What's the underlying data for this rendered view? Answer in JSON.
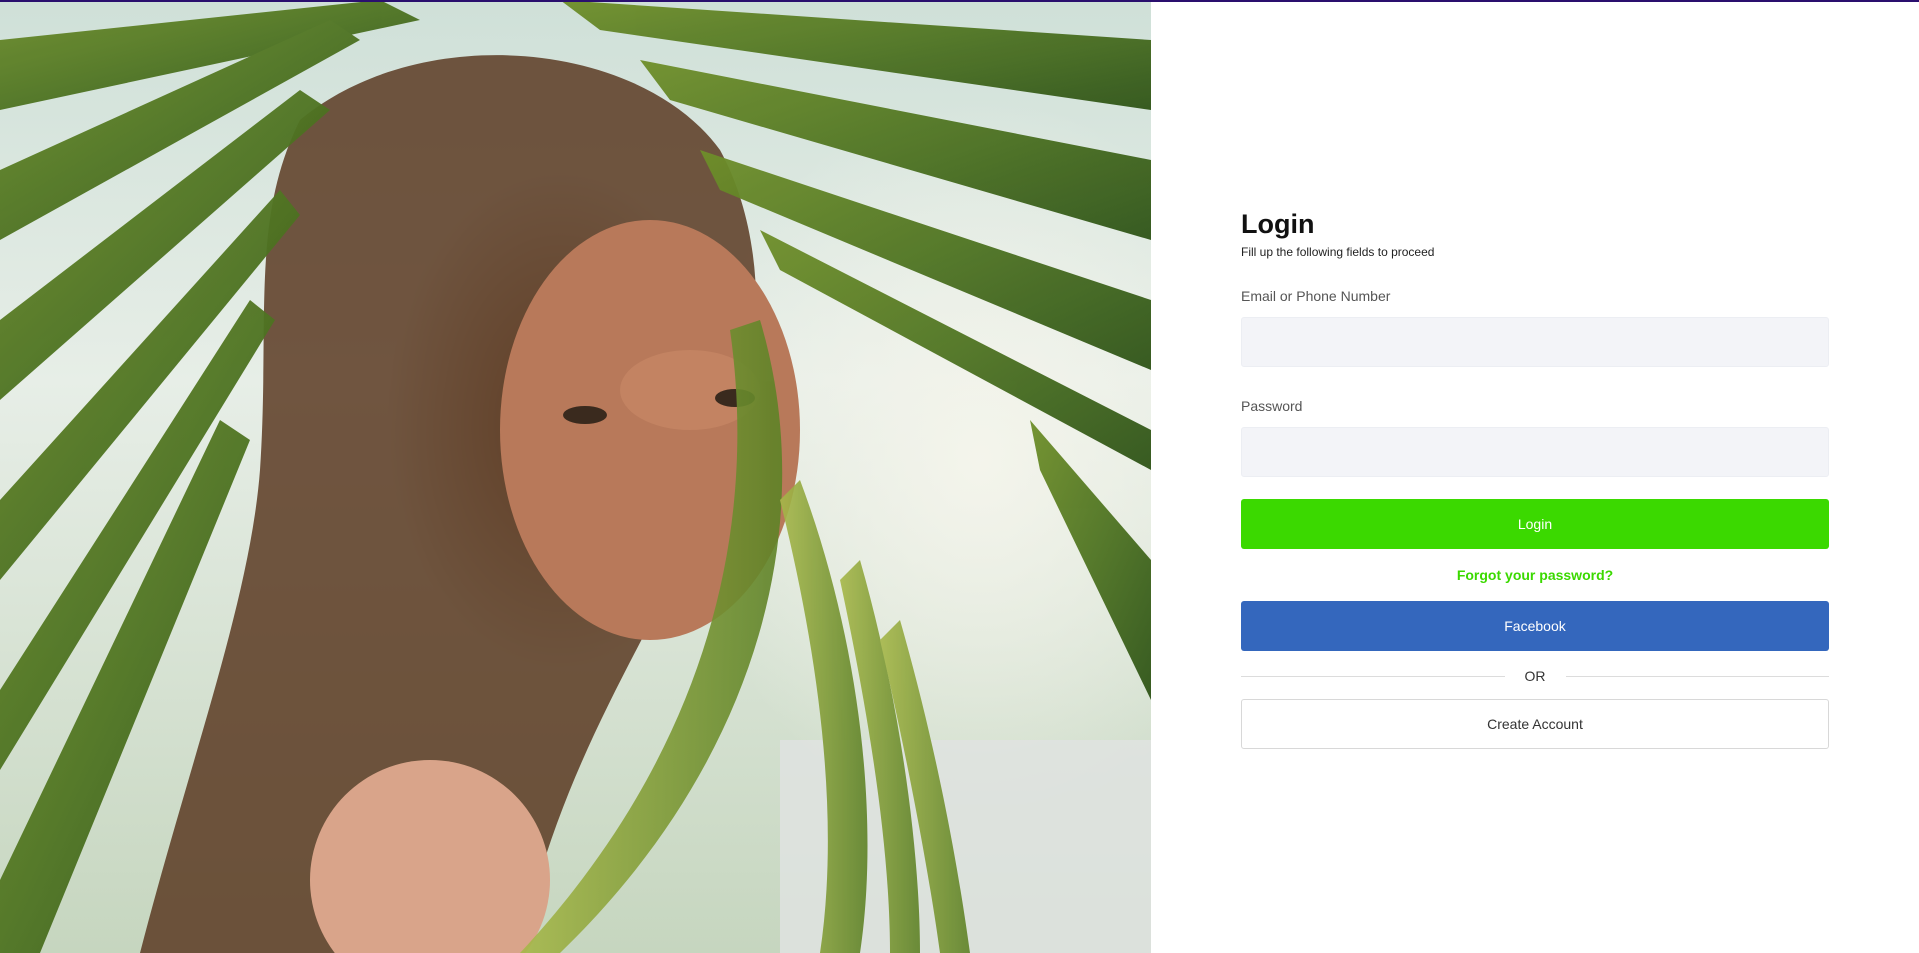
{
  "hero": {
    "image_alt": "Woman peeking through palm leaves"
  },
  "login": {
    "title": "Login",
    "subtitle": "Fill up the following fields to proceed",
    "email_label": "Email or Phone Number",
    "email_value": "",
    "password_label": "Password",
    "password_value": "",
    "submit_label": "Login",
    "forgot_label": "Forgot your password?",
    "facebook_label": "Facebook",
    "divider_label": "OR",
    "create_label": "Create Account"
  },
  "colors": {
    "accent_green": "#3bd900",
    "facebook_blue": "#3467bd",
    "input_bg": "#f3f4f8",
    "top_bar": "#2a0f6e"
  }
}
